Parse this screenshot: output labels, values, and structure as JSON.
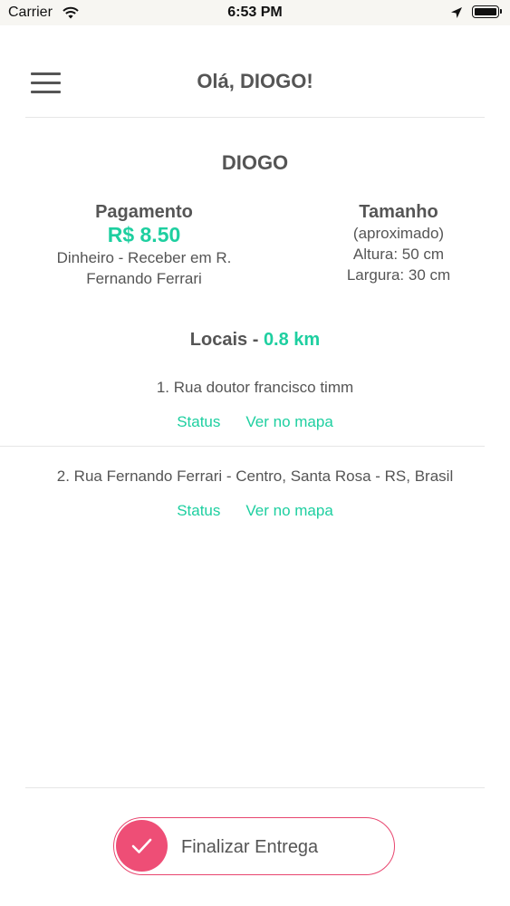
{
  "status_bar": {
    "carrier": "Carrier",
    "time": "6:53 PM",
    "icons": [
      "wifi-icon",
      "location-arrow-icon",
      "battery-icon"
    ]
  },
  "header": {
    "title": "Olá, DIOGO!",
    "menu_icon": "hamburger-menu-icon"
  },
  "delivery": {
    "client_name": "DIOGO",
    "payment": {
      "heading": "Pagamento",
      "amount": "R$ 8.50",
      "method_line1": "Dinheiro - Receber em R.",
      "method_line2": "Fernando Ferrari"
    },
    "size": {
      "heading": "Tamanho",
      "note": "(aproximado)",
      "height": "Altura: 50 cm",
      "width": "Largura: 30 cm"
    },
    "locations": {
      "label": "Locais - ",
      "distance": "0.8 km",
      "items": [
        {
          "address": "1. Rua doutor francisco timm",
          "status_link": "Status",
          "map_link": "Ver no mapa"
        },
        {
          "address": "2. Rua Fernando Ferrari - Centro, Santa Rosa - RS, Brasil",
          "status_link": "Status",
          "map_link": "Ver no mapa"
        }
      ]
    }
  },
  "footer": {
    "finalize_label": "Finalizar Entrega",
    "finalize_icon": "checkmark-icon"
  },
  "colors": {
    "accent_green": "#1ecfa0",
    "accent_pink": "#ee4e76",
    "text": "#555555"
  }
}
